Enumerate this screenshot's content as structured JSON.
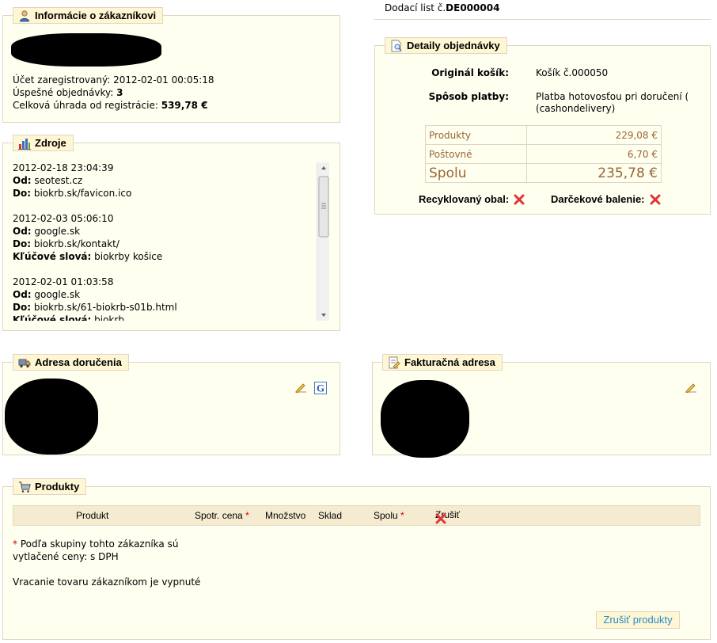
{
  "customer": {
    "title": "Informácie o zákazníkovi",
    "registered_label": "Účet zaregistrovaný:",
    "registered_value": "2012-02-01 00:05:18",
    "orders_label": "Úspešné objednávky:",
    "orders_value": "3",
    "total_label": "Celková úhrada od registrácie:",
    "total_value": "539,78 €"
  },
  "sources": {
    "title": "Zdroje",
    "entries": [
      {
        "date": "2012-02-18 23:04:39",
        "from_label": "Od:",
        "from": "seotest.cz",
        "to_label": "Do:",
        "to": "biokrb.sk/favicon.ico"
      },
      {
        "date": "2012-02-03 05:06:10",
        "from_label": "Od:",
        "from": "google.sk",
        "to_label": "Do:",
        "to": "biokrb.sk/kontakt/",
        "kw_label": "Kľúčové slová:",
        "kw": "biokrby košice"
      },
      {
        "date": "2012-02-01 01:03:58",
        "from_label": "Od:",
        "from": "google.sk",
        "to_label": "Do:",
        "to": "biokrb.sk/61-biokrb-s01b.html",
        "kw_label": "Kľúčové slová:",
        "kw": "biokrb"
      }
    ]
  },
  "delivery_slip": {
    "label": "Dodací list č.",
    "number": "DE000004"
  },
  "order_details": {
    "title": "Detaily objednávky",
    "cart_label": "Originál košík:",
    "cart_value": "Košík č.000050",
    "payment_label": "Spôsob platby:",
    "payment_value": "Platba hotovosťou pri doručení ( (cashondelivery)",
    "totals": {
      "products_label": "Produkty",
      "products_value": "229,08 €",
      "shipping_label": "Poštovné",
      "shipping_value": "6,70 €",
      "total_label": "Spolu",
      "total_value": "235,78 €"
    },
    "recycled_label": "Recyklovaný obal:",
    "gift_label": "Darčekové balenie:"
  },
  "shipping_address": {
    "title": "Adresa doručenia"
  },
  "invoice_address": {
    "title": "Fakturačná adresa"
  },
  "products": {
    "title": "Produkty",
    "columns": {
      "product": "Produkt",
      "price": "Spotr. cena",
      "quantity": "Množstvo",
      "stock": "Sklad",
      "total": "Spolu",
      "cancel": "Zrušiť"
    },
    "asterisk": "*",
    "note_line1": "Podľa skupiny tohto zákazníka sú",
    "note_line2": "vytlačené ceny: s DPH",
    "returns_note": "Vracanie tovaru zákazníkom je vypnuté",
    "cancel_button": "Zrušiť produkty"
  },
  "colors": {
    "panel_bg": "#fffff0",
    "legend_bg": "#fff6d3",
    "border": "#dfd5c3",
    "accent_brown": "#996633",
    "link_blue": "#268ccd",
    "cross_red": "#e2343a"
  }
}
